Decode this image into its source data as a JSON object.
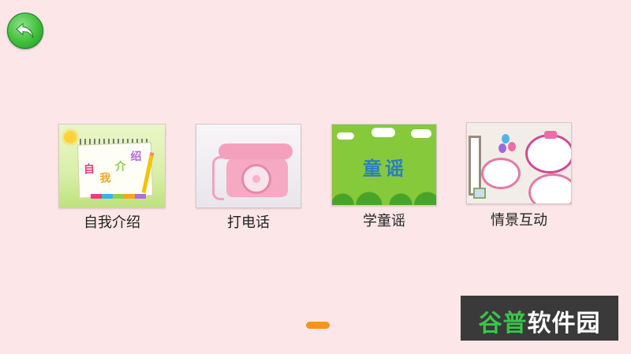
{
  "nav": {
    "back_icon": "back-arrow-icon",
    "back_color": "#3fbf3a"
  },
  "cards": [
    {
      "label": "自我介绍",
      "thumb_chars": [
        "自",
        "我",
        "介",
        "绍"
      ]
    },
    {
      "label": "打电话"
    },
    {
      "label": "学童谣",
      "thumb_text": "童谣"
    },
    {
      "label": "情景互动"
    }
  ],
  "pager": {
    "active_color": "#f7931e"
  },
  "watermark": {
    "prefix": "谷普",
    "suffix": "软件园"
  },
  "colors": {
    "background": "#fde6e8",
    "accent": "#f7931e"
  }
}
